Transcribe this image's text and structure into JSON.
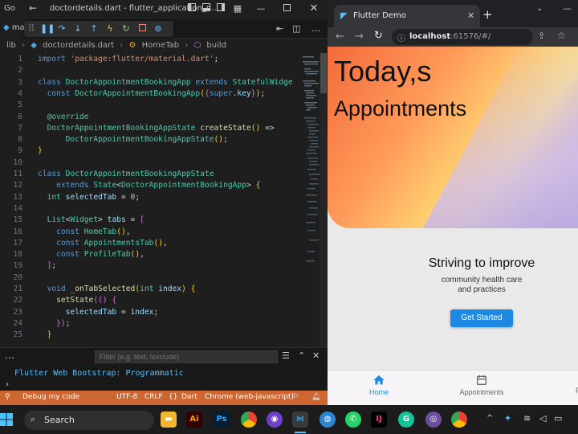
{
  "vscode": {
    "menu_label": "Go",
    "window_title": "doctordetails.dart - flutter_application_n...",
    "tab_label": "ma",
    "breadcrumbs": [
      "lib",
      "doctordetails.dart",
      "HomeTab",
      "build"
    ],
    "code_lines": [
      {
        "n": "1",
        "html": "<span class='k'>import</span> <span class='s'>'package:flutter/material.dart'</span>;"
      },
      {
        "n": "2",
        "html": ""
      },
      {
        "n": "3",
        "html": "<span class='k'>class</span> <span class='t'>DoctorAppointmentBookingApp</span> <span class='k'>extends</span> <span class='t'>StatefulWidge</span>"
      },
      {
        "n": "4",
        "html": "  <span class='k'>const</span> <span class='t'>DoctorAppointmentBookingApp</span><span class='p'>(</span><span class='p2'>{</span><span class='k'>super</span>.<span class='v'>key</span><span class='p2'>}</span><span class='p'>)</span>;"
      },
      {
        "n": "5",
        "html": ""
      },
      {
        "n": "6",
        "html": "  <span class='a'>@override</span>"
      },
      {
        "n": "7",
        "html": "  <span class='t'>DoctorAppointmentBookingAppState</span> <span class='f'>createState</span><span class='p'>()</span> =>"
      },
      {
        "n": "8",
        "html": "      <span class='t'>DoctorAppointmentBookingAppState</span><span class='p'>()</span>;"
      },
      {
        "n": "9",
        "html": "<span class='p'>}</span>"
      },
      {
        "n": "10",
        "html": ""
      },
      {
        "n": "11",
        "html": "<span class='k'>class</span> <span class='t'>DoctorAppointmentBookingAppState</span>"
      },
      {
        "n": "12",
        "html": "    <span class='k'>extends</span> <span class='t'>State</span>&lt;<span class='t'>DoctorAppointmentBookingApp</span>&gt; <span class='p'>{</span>"
      },
      {
        "n": "13",
        "html": "  <span class='t'>int</span> <span class='v'>selectedTab</span> = <span class='n'>0</span>;"
      },
      {
        "n": "14",
        "html": ""
      },
      {
        "n": "15",
        "html": "  <span class='t'>List</span>&lt;<span class='t'>Widget</span>&gt; <span class='v'>tabs</span> = <span class='p2'>[</span>"
      },
      {
        "n": "16",
        "html": "    <span class='k'>const</span> <span class='t'>HomeTab</span><span class='p'>()</span>,"
      },
      {
        "n": "17",
        "html": "    <span class='k'>const</span> <span class='t'>AppointmentsTab</span><span class='p'>()</span>,"
      },
      {
        "n": "18",
        "html": "    <span class='k'>const</span> <span class='t'>ProfileTab</span><span class='p'>()</span>,"
      },
      {
        "n": "19",
        "html": "  <span class='p2'>]</span>;"
      },
      {
        "n": "20",
        "html": ""
      },
      {
        "n": "21",
        "html": "  <span class='k'>void</span> <span class='f'>_onTabSelected</span><span class='p'>(</span><span class='t'>int</span> <span class='v'>index</span><span class='p'>)</span> <span class='p'>{</span>"
      },
      {
        "n": "22",
        "html": "    <span class='f'>setState</span><span class='p2'>(()</span> <span class='p2'>{</span>"
      },
      {
        "n": "23",
        "html": "      <span class='v'>selectedTab</span> = <span class='v'>index</span>;"
      },
      {
        "n": "24",
        "html": "    <span class='p2'>})</span>;"
      },
      {
        "n": "25",
        "html": "  <span class='p'>}</span>"
      }
    ],
    "filter_placeholder": "Filter (e.g. text, !exclude)",
    "output_line": "Flutter Web Bootstrap: Programmatic",
    "status": {
      "debug": "Debug my code",
      "encoding": "UTF-8",
      "eol": "CRLF",
      "language": "Dart",
      "device": "Chrome (web-javascript)"
    },
    "accent_color": "#cc6633"
  },
  "browser": {
    "tab_title": "Flutter Demo",
    "url_host": "localhost",
    "url_rest": ":61576/#/",
    "app": {
      "title_line1": "Today,s",
      "title_line2": "Appointments",
      "tagline": "Striving to improve",
      "subtext_line1": "community health care",
      "subtext_line2": "and practices",
      "cta": "Get Started",
      "nav": [
        {
          "label": "Home",
          "icon": "home-icon",
          "active": true
        },
        {
          "label": "Appointments",
          "icon": "calendar-icon",
          "active": false
        },
        {
          "label": "P",
          "icon": "profile-icon",
          "active": false
        }
      ],
      "primary_color": "#1e88e5"
    }
  },
  "taskbar": {
    "search_label": "Search"
  }
}
